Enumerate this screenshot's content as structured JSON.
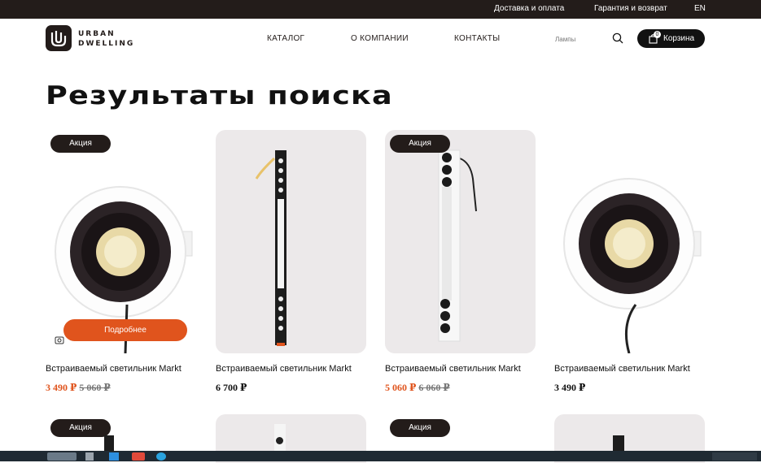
{
  "topbar": {
    "delivery": "Доставка и оплата",
    "warranty": "Гарантия и возврат",
    "lang": "EN"
  },
  "header": {
    "logo_line1": "URBAN",
    "logo_line2": "DWELLING",
    "nav": [
      "КАТАЛОГ",
      "О КОМПАНИИ",
      "КОНТАКТЫ"
    ],
    "search_placeholder": "Лампы",
    "cart_label": "Корзина",
    "cart_count": "0"
  },
  "page": {
    "title": "Результаты поиска"
  },
  "products": [
    {
      "title": "Встраиваемый светильник Markt",
      "price": "3 490 ₽",
      "old_price": "5 060 ₽",
      "badge": "Акция",
      "button": "Подробнее",
      "icon": "downlight-round"
    },
    {
      "title": "Встраиваемый светильник Markt",
      "price": "6 700 ₽",
      "old_price": "",
      "badge": "",
      "icon": "linear-black"
    },
    {
      "title": "Встраиваемый светильник Markt",
      "price": "5 060 ₽",
      "old_price": "6 060 ₽",
      "badge": "Акция",
      "icon": "linear-white"
    },
    {
      "title": "Встраиваемый светильник Markt",
      "price": "3 490 ₽",
      "old_price": "",
      "badge": "",
      "icon": "downlight-round"
    }
  ],
  "row2_badges": [
    "Акция",
    "Акция"
  ],
  "colors": {
    "accent": "#e0541d",
    "dark": "#231c1a"
  }
}
